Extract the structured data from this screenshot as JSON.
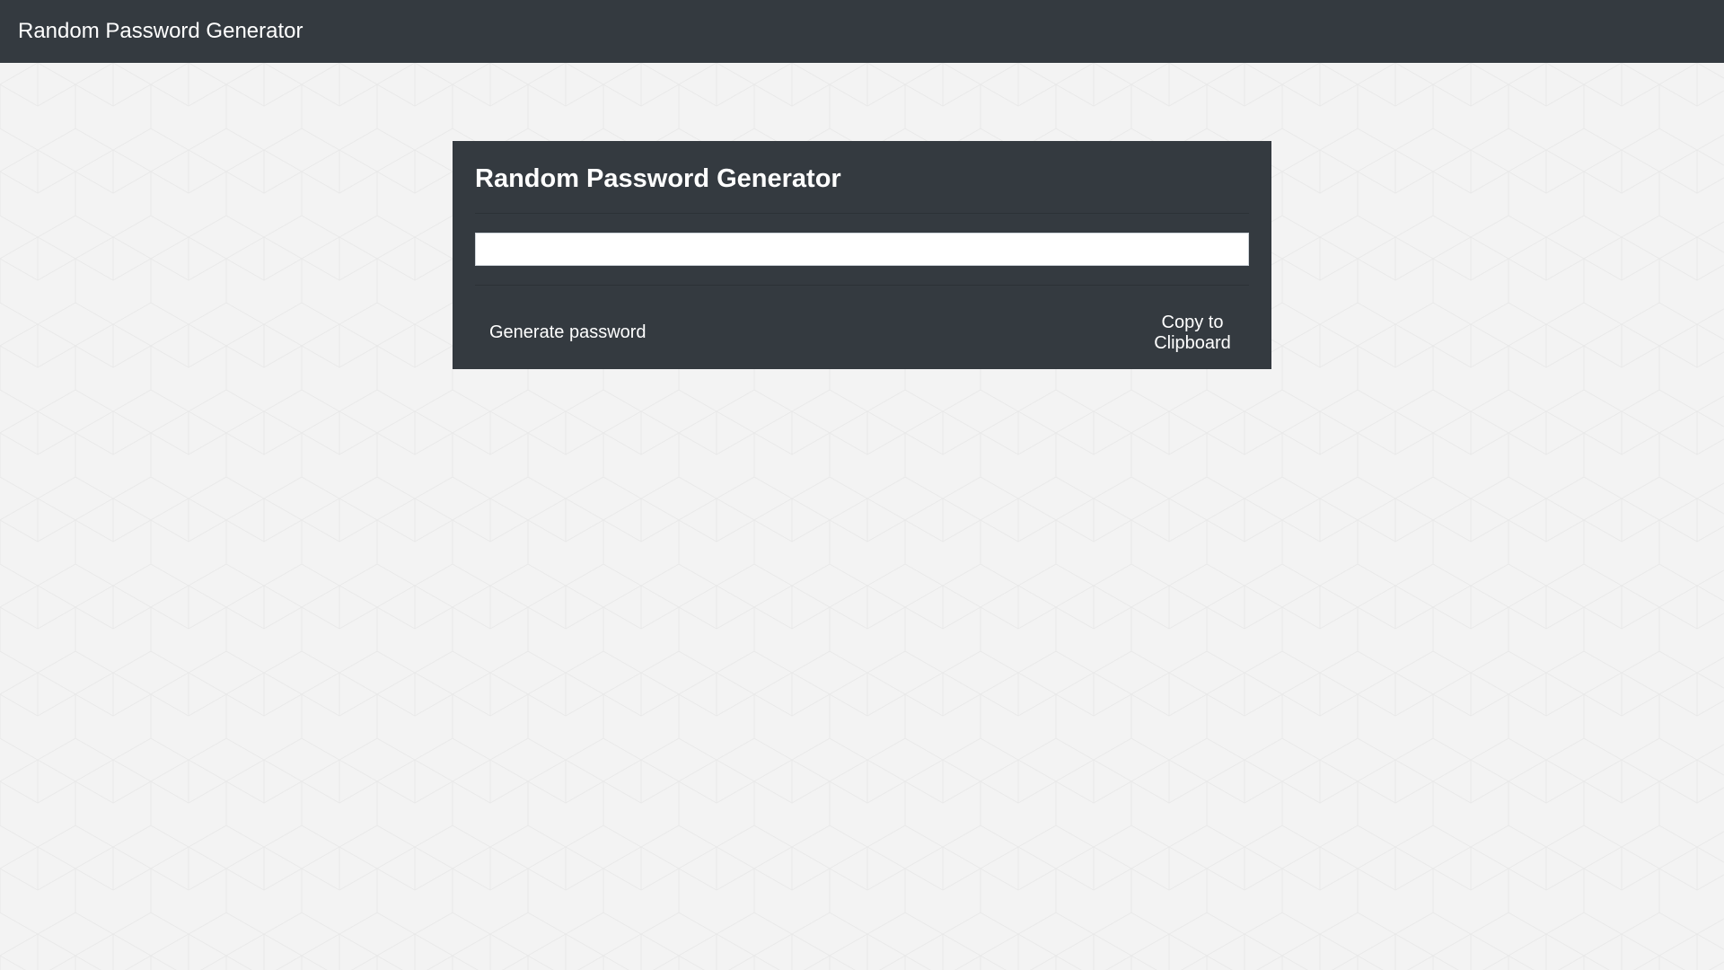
{
  "navbar": {
    "brand": "Random Password Generator"
  },
  "card": {
    "title": "Random Password Generator",
    "password_value": "",
    "generate_label": "Generate password",
    "copy_label": "Copy to Clipboard"
  },
  "colors": {
    "navbar_bg": "#343a40",
    "card_bg": "#343a40",
    "page_bg": "#f3f3f3",
    "text": "#ffffff"
  }
}
